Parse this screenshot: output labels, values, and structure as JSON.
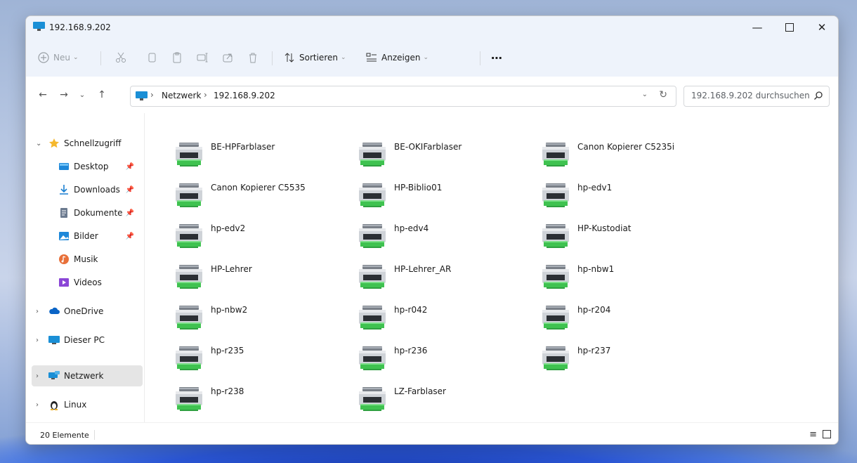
{
  "window": {
    "title": "192.168.9.202"
  },
  "toolbar": {
    "new_label": "Neu",
    "sort_label": "Sortieren",
    "view_label": "Anzeigen",
    "more_label": "⋯"
  },
  "address": {
    "segments": [
      "Netzwerk",
      "192.168.9.202"
    ],
    "search_placeholder": "192.168.9.202 durchsuchen"
  },
  "sidebar": {
    "items": [
      {
        "label": "Schnellzugriff",
        "icon": "star-icon"
      },
      {
        "label": "Desktop",
        "icon": "desktop-folder-icon",
        "pinned": true
      },
      {
        "label": "Downloads",
        "icon": "download-arrow-icon",
        "pinned": true
      },
      {
        "label": "Dokumente",
        "icon": "document-icon",
        "pinned": true
      },
      {
        "label": "Bilder",
        "icon": "pictures-icon",
        "pinned": true
      },
      {
        "label": "Musik",
        "icon": "music-icon"
      },
      {
        "label": "Videos",
        "icon": "videos-icon"
      },
      {
        "label": "OneDrive",
        "icon": "cloud-icon"
      },
      {
        "label": "Dieser PC",
        "icon": "pc-icon"
      },
      {
        "label": "Netzwerk",
        "icon": "network-icon",
        "selected": true
      },
      {
        "label": "Linux",
        "icon": "linux-penguin-icon"
      }
    ]
  },
  "printers": [
    "BE-HPFarblaser",
    "BE-OKIFarblaser",
    "Canon Kopierer C5235i",
    "Canon Kopierer C5535",
    "HP-Biblio01",
    "hp-edv1",
    "hp-edv2",
    "hp-edv4",
    "HP-Kustodiat",
    "HP-Lehrer",
    "HP-Lehrer_AR",
    "hp-nbw1",
    "hp-nbw2",
    "hp-r042",
    "hp-r204",
    "hp-r235",
    "hp-r236",
    "hp-r237",
    "hp-r238",
    "LZ-Farblaser"
  ],
  "status": {
    "count_text": "20 Elemente"
  },
  "colors": {
    "accent": "#0067c0",
    "printer_tray": "#3fc250",
    "selected_bg": "#e5e5e5"
  }
}
